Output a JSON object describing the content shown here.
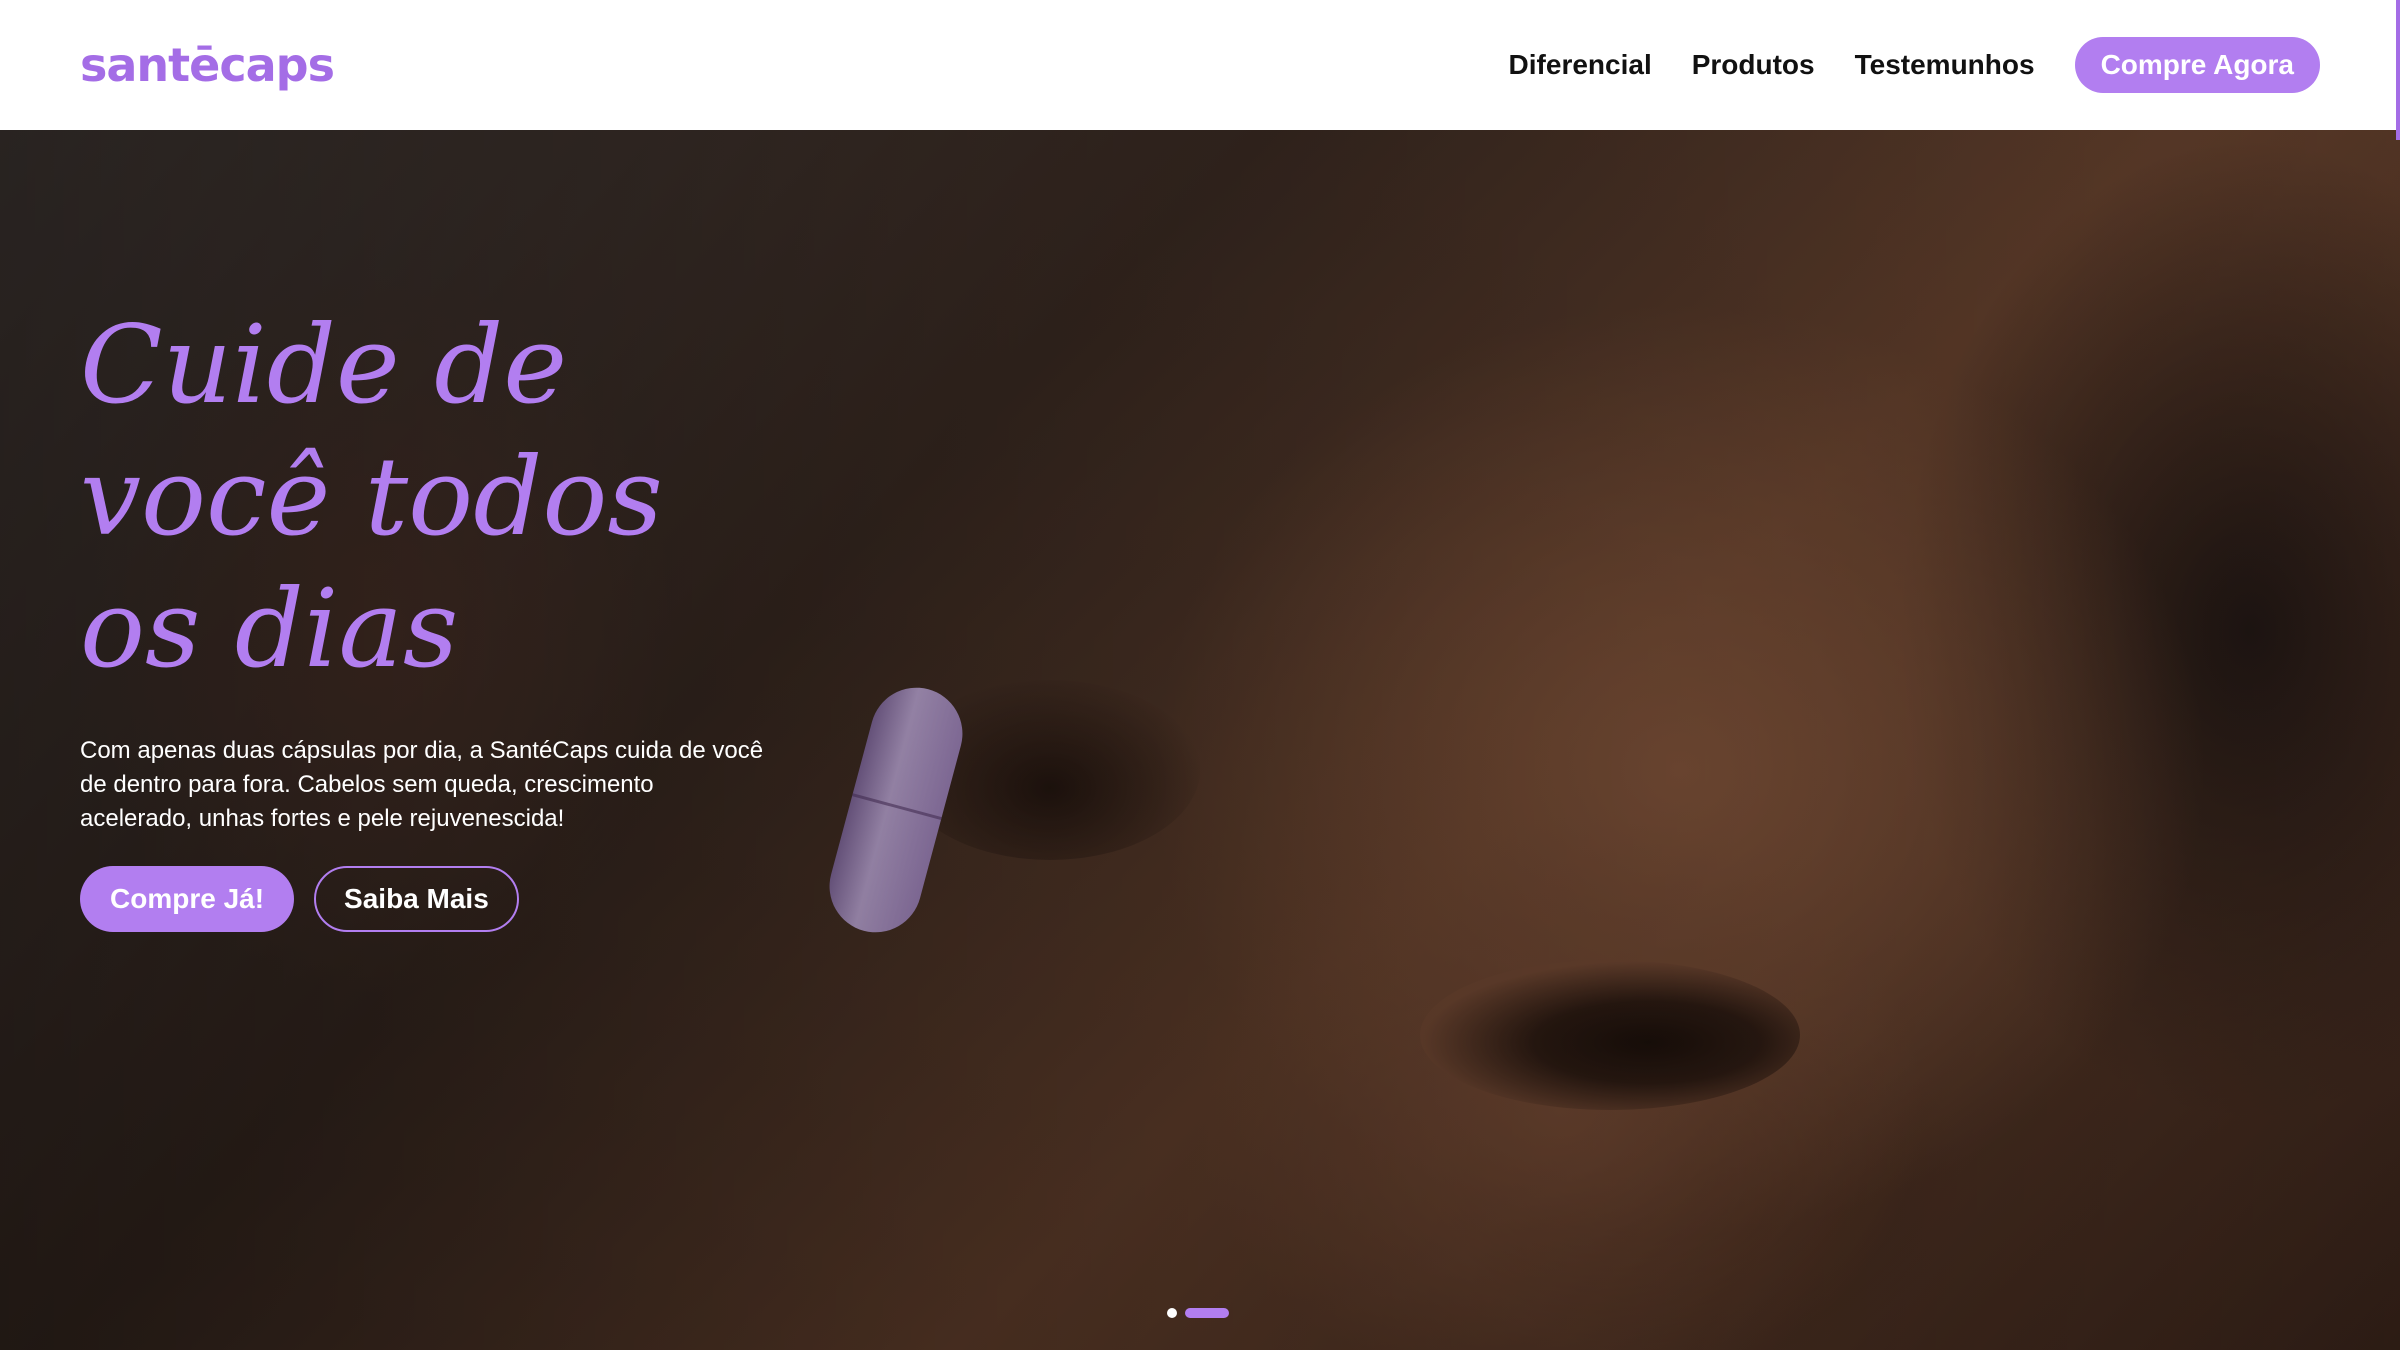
{
  "header": {
    "logo_text": "santēcaps",
    "nav": [
      {
        "label": "Diferencial"
      },
      {
        "label": "Produtos"
      },
      {
        "label": "Testemunhos"
      }
    ],
    "cta_label": "Compre Agora"
  },
  "hero": {
    "headline": "Cuide de\nvocê todos\nos dias",
    "subtext": "Com apenas duas cápsulas por dia, a SantéCaps cuida de você de dentro para fora. Cabelos sem queda, crescimento acelerado, unhas fortes e pele rejuvenescida!",
    "primary_button": "Compre Já!",
    "secondary_button": "Saiba Mais",
    "carousel": {
      "slides": 2,
      "active_index": 1
    }
  },
  "colors": {
    "accent": "#b27ef0",
    "logo": "#a46de6",
    "nav_text": "#111111",
    "header_bg": "#ffffff"
  }
}
